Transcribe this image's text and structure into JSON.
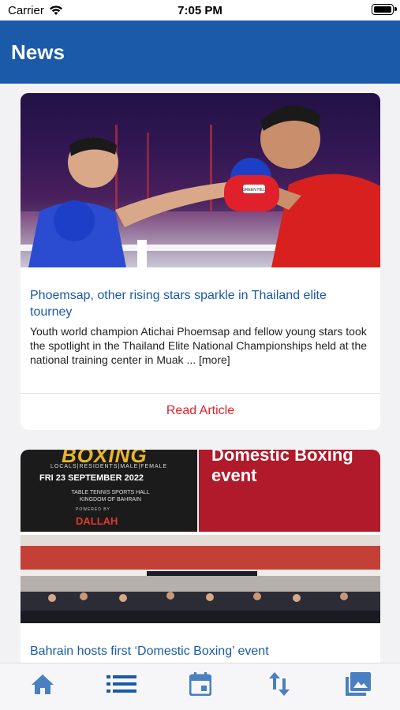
{
  "status_bar": {
    "carrier": "Carrier",
    "time": "7:05 PM"
  },
  "header": {
    "title": "News"
  },
  "articles": [
    {
      "title": "Phoemsap, other rising stars sparkle in Thailand elite tourney",
      "excerpt": "Youth world champion Atichai Phoemsap and fellow young stars took the spotlight in the Thailand Elite National Championships held at the national training center in Muak ... [more]",
      "action_label": "Read Article",
      "glove_brand": "GREEN HILL"
    },
    {
      "title": "Bahrain hosts first ‘Domestic Boxing’ event",
      "poster": {
        "boxing_word": "BOXING",
        "tagline": "LOCALS|RESIDENTS|MALE|FEMALE",
        "date": "FRI 23 SEPTEMBER 2022",
        "venue_line_1": "TABLE TENNIS SPORTS HALL",
        "venue_line_2": "KINGDOM OF BAHRAIN",
        "powered_by": "POWERED BY",
        "sponsor": "DALLAH",
        "headline_line_1": "Domestic Boxing",
        "headline_line_2": "event"
      }
    }
  ],
  "tab_bar": {
    "items": [
      "home-icon",
      "list-icon",
      "calendar-icon",
      "sort-icon",
      "gallery-icon"
    ],
    "active_color": "#1a5aa8",
    "inactive_color": "#4a7fc1"
  },
  "colors": {
    "header_bg": "#1a5aa8",
    "link_title": "#1a5aa8",
    "action_red": "#e0212b"
  }
}
